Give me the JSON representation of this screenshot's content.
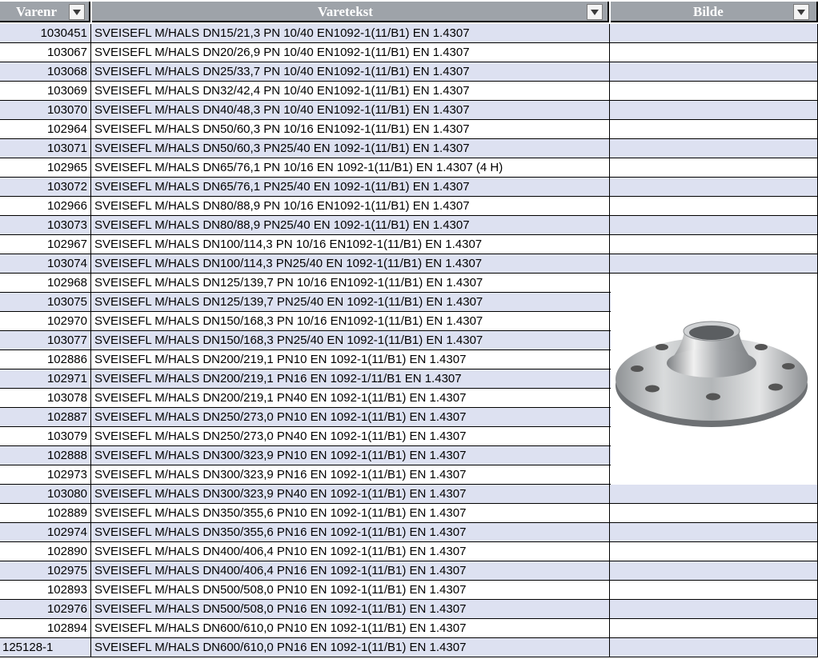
{
  "columns": [
    {
      "label": "Varenr"
    },
    {
      "label": "Varetekst"
    },
    {
      "label": "Bilde"
    }
  ],
  "image": {
    "alt": "weld neck flange",
    "icon": "flange-photo"
  },
  "rows": [
    {
      "nr": "1030451",
      "text": "SVEISEFL M/HALS DN15/21,3 PN 10/40 EN1092-1(11/B1) EN 1.4307"
    },
    {
      "nr": "103067",
      "text": "SVEISEFL M/HALS DN20/26,9 PN 10/40 EN1092-1(11/B1) EN 1.4307"
    },
    {
      "nr": "103068",
      "text": "SVEISEFL M/HALS DN25/33,7 PN 10/40 EN1092-1(11/B1) EN 1.4307"
    },
    {
      "nr": "103069",
      "text": "SVEISEFL M/HALS DN32/42,4 PN 10/40 EN1092-1(11/B1) EN 1.4307"
    },
    {
      "nr": "103070",
      "text": "SVEISEFL M/HALS DN40/48,3 PN 10/40 EN1092-1(11/B1) EN 1.4307"
    },
    {
      "nr": "102964",
      "text": "SVEISEFL M/HALS DN50/60,3 PN 10/16 EN1092-1(11/B1) EN 1.4307"
    },
    {
      "nr": "103071",
      "text": "SVEISEFL M/HALS DN50/60,3 PN25/40 EN 1092-1(11/B1) EN 1.4307"
    },
    {
      "nr": "102965",
      "text": "SVEISEFL M/HALS DN65/76,1 PN 10/16 EN 1092-1(11/B1) EN 1.4307 (4 H)"
    },
    {
      "nr": "103072",
      "text": "SVEISEFL M/HALS DN65/76,1 PN25/40 EN 1092-1(11/B1) EN 1.4307"
    },
    {
      "nr": "102966",
      "text": "SVEISEFL M/HALS DN80/88,9 PN 10/16 EN1092-1(11/B1) EN 1.4307"
    },
    {
      "nr": "103073",
      "text": "SVEISEFL M/HALS DN80/88,9 PN25/40 EN 1092-1(11/B1) EN 1.4307"
    },
    {
      "nr": "102967",
      "text": "SVEISEFL M/HALS DN100/114,3 PN 10/16 EN1092-1(11/B1) EN 1.4307"
    },
    {
      "nr": "103074",
      "text": "SVEISEFL M/HALS DN100/114,3 PN25/40 EN 1092-1(11/B1) EN 1.4307"
    },
    {
      "nr": "102968",
      "text": "SVEISEFL M/HALS DN125/139,7 PN 10/16 EN1092-1(11/B1) EN 1.4307"
    },
    {
      "nr": "103075",
      "text": "SVEISEFL M/HALS DN125/139,7 PN25/40 EN 1092-1(11/B1) EN 1.4307"
    },
    {
      "nr": "102970",
      "text": "SVEISEFL M/HALS DN150/168,3 PN 10/16 EN1092-1(11/B1) EN 1.4307"
    },
    {
      "nr": "103077",
      "text": "SVEISEFL M/HALS DN150/168,3 PN25/40 EN 1092-1(11/B1) EN 1.4307"
    },
    {
      "nr": "102886",
      "text": "SVEISEFL M/HALS DN200/219,1 PN10 EN 1092-1(11/B1) EN 1.4307"
    },
    {
      "nr": "102971",
      "text": "SVEISEFL M/HALS DN200/219,1 PN16 EN 1092-1/11/B1 EN 1.4307"
    },
    {
      "nr": "103078",
      "text": "SVEISEFL M/HALS DN200/219,1 PN40 EN 1092-1(11/B1) EN 1.4307"
    },
    {
      "nr": "102887",
      "text": "SVEISEFL M/HALS DN250/273,0 PN10 EN 1092-1(11/B1) EN 1.4307"
    },
    {
      "nr": "103079",
      "text": "SVEISEFL M/HALS DN250/273,0 PN40 EN 1092-1(11/B1) EN 1.4307"
    },
    {
      "nr": "102888",
      "text": "SVEISEFL M/HALS DN300/323,9 PN10 EN 1092-1(11/B1) EN 1.4307"
    },
    {
      "nr": "102973",
      "text": "SVEISEFL M/HALS DN300/323,9 PN16 EN 1092-1(11/B1) EN 1.4307"
    },
    {
      "nr": "103080",
      "text": "SVEISEFL M/HALS DN300/323,9 PN40 EN 1092-1(11/B1) EN 1.4307"
    },
    {
      "nr": "102889",
      "text": "SVEISEFL M/HALS DN350/355,6 PN10 EN 1092-1(11/B1) EN 1.4307"
    },
    {
      "nr": "102974",
      "text": "SVEISEFL M/HALS DN350/355,6 PN16 EN 1092-1(11/B1) EN 1.4307"
    },
    {
      "nr": "102890",
      "text": "SVEISEFL M/HALS DN400/406,4 PN10 EN 1092-1(11/B1) EN 1.4307"
    },
    {
      "nr": "102975",
      "text": "SVEISEFL M/HALS DN400/406,4 PN16 EN 1092-1(11/B1) EN 1.4307"
    },
    {
      "nr": "102893",
      "text": "SVEISEFL M/HALS DN500/508,0 PN10 EN 1092-1(11/B1) EN 1.4307"
    },
    {
      "nr": "102976",
      "text": "SVEISEFL M/HALS DN500/508,0 PN16 EN 1092-1(11/B1) EN 1.4307"
    },
    {
      "nr": "102894",
      "text": "SVEISEFL M/HALS DN600/610,0 PN10 EN 1092-1(11/B1) EN 1.4307"
    },
    {
      "nr": "125128-1",
      "text": "SVEISEFL M/HALS DN600/610,0 PN16 EN 1092-1(11/B1) EN 1.4307"
    }
  ]
}
